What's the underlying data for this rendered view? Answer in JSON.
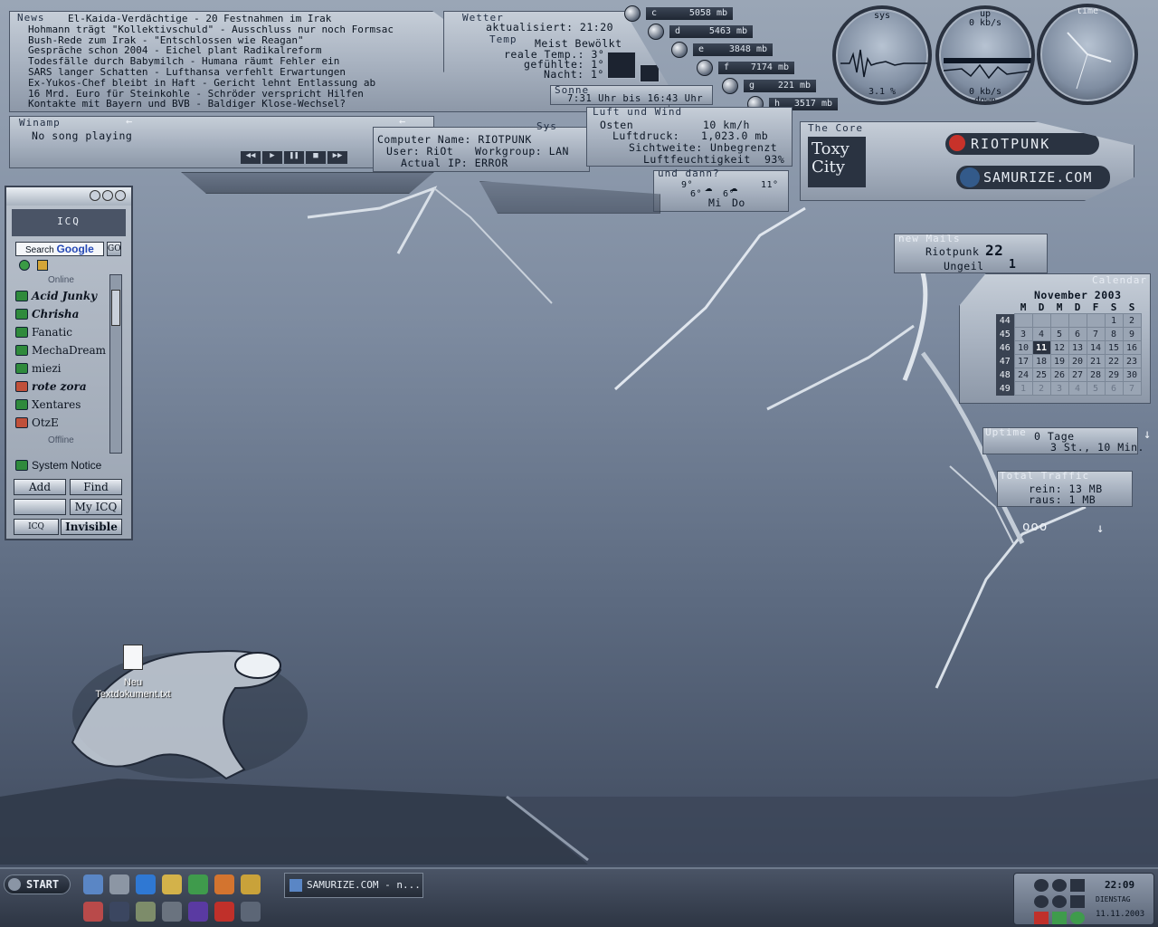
{
  "news": {
    "label": "News",
    "items": [
      "El-Kaida-Verdächtige - 20 Festnahmen im Irak",
      "Hohmann trägt \"Kollektivschuld\" - Ausschluss nur noch Formsac",
      "Bush-Rede zum Irak - \"Entschlossen wie Reagan\"",
      "Gespräche schon 2004 - Eichel plant Radikalreform",
      "Todesfälle durch Babymilch - Humana räumt Fehler ein",
      "SARS langer Schatten - Lufthansa verfehlt Erwartungen",
      "Ex-Yukos-Chef bleibt in Haft - Gericht lehnt Entlassung ab",
      "16 Mrd. Euro für Steinkohle - Schröder verspricht Hilfen",
      "Kontakte mit Bayern und BVB - Baldiger Klose-Wechsel?"
    ]
  },
  "weather": {
    "label": "Wetter",
    "updated": "aktualisiert: 21:20",
    "temp_label": "Temp",
    "condition": "Meist Bewölkt",
    "real_temp": "reale Temp.: 3°",
    "felt": "gefühlte: 1°",
    "night": "Nacht: 1°",
    "sun_label": "Sonne",
    "sun_times": "7:31 Uhr  bis  16:43 Uhr",
    "wind_label": "Luft und Wind",
    "wind_dir": "Osten",
    "wind_speed": "10 km/h",
    "pressure_label": "Luftdruck:",
    "pressure": "1,023.0 mb",
    "visibility_label": "Sichtweite:",
    "visibility": "Unbegrenzt",
    "humidity_label": "Luftfeuchtigkeit",
    "humidity": "93%",
    "forecast_label": "und dann?",
    "fc_day1": "Mi",
    "fc_day2": "Do",
    "fc_t1_hi": "9°",
    "fc_t1_lo": "6°",
    "fc_t2_lo": "6°",
    "fc_t2_hi": "11°"
  },
  "drives": [
    {
      "letter": "c",
      "size": "5058 mb"
    },
    {
      "letter": "d",
      "size": "5463 mb"
    },
    {
      "letter": "e",
      "size": "3848 mb"
    },
    {
      "letter": "f",
      "size": "7174 mb"
    },
    {
      "letter": "g",
      "size": "221 mb"
    },
    {
      "letter": "h",
      "size": "3517 mb"
    }
  ],
  "gauges": {
    "sys_label": "sys",
    "sys_value": "3.1 %",
    "up_label": "up",
    "up_value": "0 kb/s",
    "down_label": "down",
    "down_value": "0 kb/s",
    "time_label": "time"
  },
  "winamp": {
    "label": "Winamp",
    "status": "No song playing"
  },
  "sys": {
    "label": "Sys",
    "computer_name": "Computer Name: RIOTPUNK",
    "user": "User: RiOt",
    "workgroup": "Workgroup: LAN",
    "ip": "Actual IP: ERROR"
  },
  "core": {
    "label": "The Core",
    "logo_text": "Toxy City",
    "link1": "RIOTPUNK",
    "link2": "SAMURIZE.COM"
  },
  "mail": {
    "label": "new Mails",
    "acc1": "Riotpunk",
    "count1": "22",
    "acc2": "Ungeil",
    "count2": "1"
  },
  "calendar": {
    "label": "Calendar",
    "month": "November 2003",
    "headers": [
      "M",
      "D",
      "M",
      "D",
      "F",
      "S",
      "S"
    ],
    "weeks": [
      {
        "wk": "44",
        "days": [
          "",
          "",
          "",
          "",
          "",
          "1",
          "2"
        ]
      },
      {
        "wk": "45",
        "days": [
          "3",
          "4",
          "5",
          "6",
          "7",
          "8",
          "9"
        ]
      },
      {
        "wk": "46",
        "days": [
          "10",
          "11",
          "12",
          "13",
          "14",
          "15",
          "16"
        ]
      },
      {
        "wk": "47",
        "days": [
          "17",
          "18",
          "19",
          "20",
          "21",
          "22",
          "23"
        ]
      },
      {
        "wk": "48",
        "days": [
          "24",
          "25",
          "26",
          "27",
          "28",
          "29",
          "30"
        ]
      },
      {
        "wk": "49",
        "days": [
          "1",
          "2",
          "3",
          "4",
          "5",
          "6",
          "7"
        ]
      }
    ],
    "today": "11"
  },
  "uptime": {
    "label": "Uptime",
    "days": "0 Tage",
    "hours": "3 St., 10 Min."
  },
  "traffic": {
    "label": "Total Traffic",
    "in": "rein: 13 MB",
    "out": "raus: 1 MB",
    "dots": "ooo"
  },
  "icq": {
    "title": "ICQ",
    "search_label": "Search",
    "search_brand": "Google",
    "go": "GO",
    "online_label": "Online",
    "offline_label": "Offline",
    "contacts": [
      "Acid Junky",
      "Chrisha",
      "Fanatic",
      "MechaDream",
      "miezi",
      "rote zora",
      "Xentares",
      "OtzE"
    ],
    "system_notice": "System Notice",
    "add": "Add",
    "find": "Find",
    "myicq": "My ICQ",
    "status": "Invisible",
    "icq_btn": "ICQ"
  },
  "desktop_icon": {
    "label": "Neu Textdokument.txt"
  },
  "taskbar": {
    "start": "START",
    "task": "SAMURIZE.COM - n...",
    "time": "22:09",
    "day": "DIENSTAG",
    "date": "11.11.2003"
  },
  "colors": {
    "accent": "#0b1420",
    "panel": "#a9b3c1",
    "bg_top": "#9aa6b6",
    "bg_bottom": "#3a4457"
  }
}
